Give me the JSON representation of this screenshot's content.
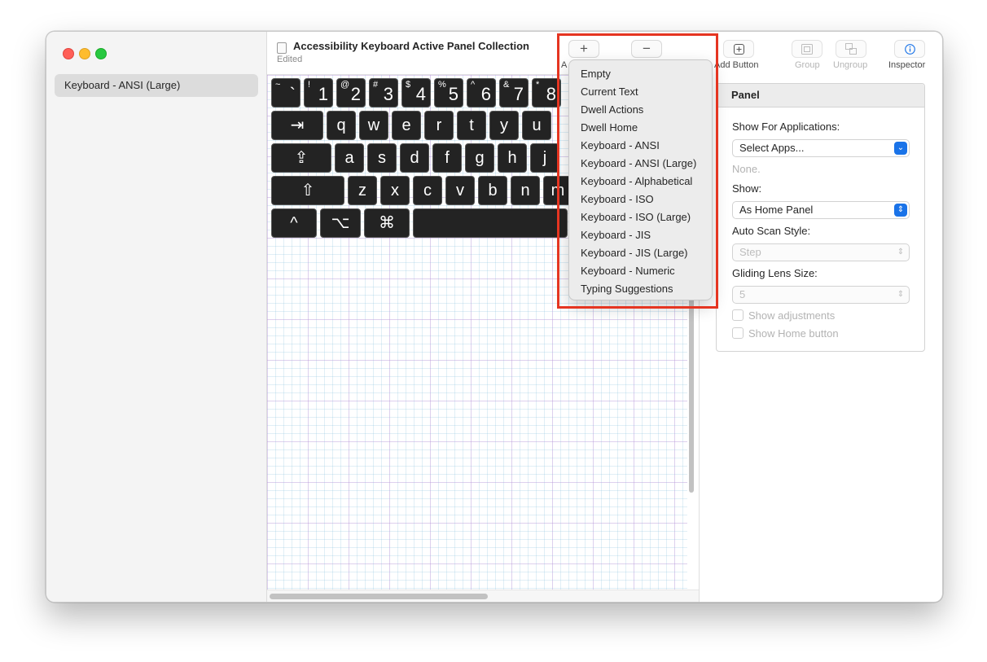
{
  "window": {
    "title": "Accessibility Keyboard Active Panel Collection",
    "subtitle": "Edited"
  },
  "sidebar": {
    "items": [
      {
        "label": "Keyboard - ANSI (Large)",
        "selected": true
      }
    ]
  },
  "toolbar": {
    "add_panel_symbol": "+",
    "add_panel_label": "A",
    "remove_symbol": "−",
    "add_button_label": "Add Button",
    "group_label": "Group",
    "ungroup_label": "Ungroup",
    "inspector_label": "Inspector"
  },
  "keyboard": {
    "row1": [
      {
        "sup": "~",
        "main": "`"
      },
      {
        "sup": "!",
        "main": "1"
      },
      {
        "sup": "@",
        "main": "2"
      },
      {
        "sup": "#",
        "main": "3"
      },
      {
        "sup": "$",
        "main": "4"
      },
      {
        "sup": "%",
        "main": "5"
      },
      {
        "sup": "^",
        "main": "6"
      },
      {
        "sup": "&",
        "main": "7"
      },
      {
        "sup": "*",
        "main": "8"
      }
    ],
    "row2": [
      "⇥",
      "q",
      "w",
      "e",
      "r",
      "t",
      "y",
      "u"
    ],
    "row3": [
      "⇪",
      "a",
      "s",
      "d",
      "f",
      "g",
      "h",
      "j"
    ],
    "row4": [
      "⇧",
      "z",
      "x",
      "c",
      "v",
      "b",
      "n",
      "m"
    ],
    "row5": [
      "^",
      "⌥",
      "⌘",
      ""
    ]
  },
  "add_panel_menu": {
    "items": [
      "Empty",
      "Current Text",
      "Dwell Actions",
      "Dwell Home",
      "Keyboard - ANSI",
      "Keyboard - ANSI (Large)",
      "Keyboard - Alphabetical",
      "Keyboard - ISO",
      "Keyboard - ISO (Large)",
      "Keyboard - JIS",
      "Keyboard - JIS (Large)",
      "Keyboard - Numeric",
      "Typing Suggestions"
    ]
  },
  "inspector": {
    "panel_title": "Panel",
    "show_for_apps_label": "Show For Applications:",
    "show_for_apps_value": "Select Apps...",
    "apps_none": "None.",
    "show_label": "Show:",
    "show_value": "As Home Panel",
    "auto_scan_label": "Auto Scan Style:",
    "auto_scan_value": "Step",
    "lens_label": "Gliding Lens Size:",
    "lens_value": "5",
    "show_adjustments": "Show adjustments",
    "show_home_button": "Show Home button"
  },
  "colors": {
    "highlight": "#e53521",
    "accent": "#1a73e8",
    "key_background": "#232323"
  }
}
